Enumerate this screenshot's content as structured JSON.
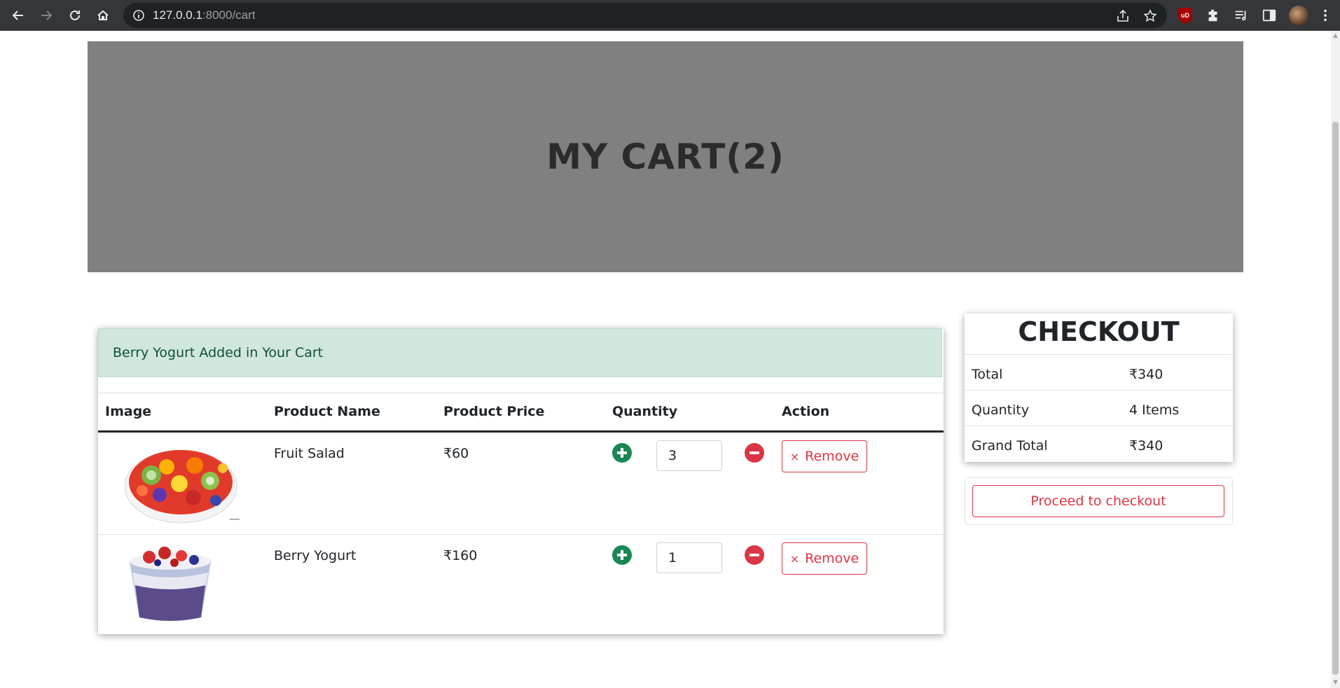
{
  "browser": {
    "url_host": "127.0.0.1",
    "url_path": ":8000/cart",
    "ublock_badge": "uD"
  },
  "hero": {
    "title": "MY CART(2)"
  },
  "alert": {
    "message": "Berry Yogurt Added in Your Cart"
  },
  "table": {
    "headers": [
      "Image",
      "Product Name",
      "Product Price",
      "Quantity",
      "Action"
    ],
    "rows": [
      {
        "name": "Fruit Salad",
        "price": "₹60",
        "quantity": "3",
        "action": "Remove"
      },
      {
        "name": "Berry Yogurt",
        "price": "₹160",
        "quantity": "1",
        "action": "Remove"
      }
    ],
    "remove_symbol": "×"
  },
  "checkout": {
    "title": "CHECKOUT",
    "rows": [
      {
        "label": "Total",
        "value": "₹340"
      },
      {
        "label": "Quantity",
        "value": "4 Items"
      },
      {
        "label": "Grand Total",
        "value": "₹340"
      }
    ],
    "proceed_label": "Proceed to checkout"
  },
  "colors": {
    "hero_bg": "#808080",
    "alert_bg": "#d1e7dd",
    "success": "#198754",
    "danger": "#dc3545"
  }
}
